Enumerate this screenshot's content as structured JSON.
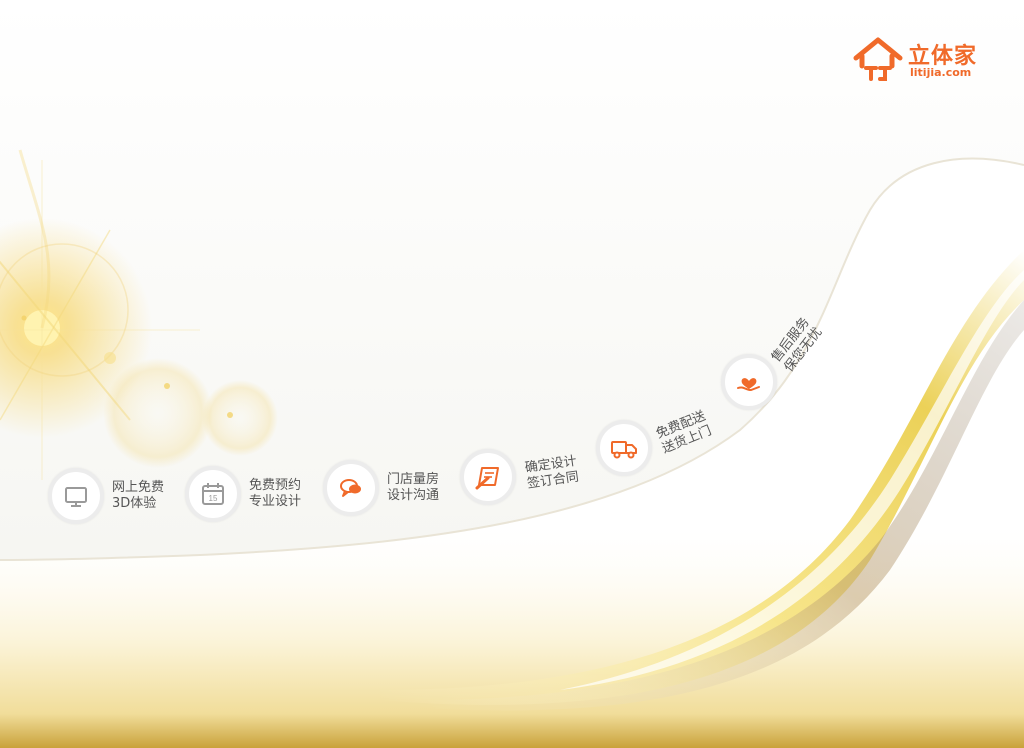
{
  "brand": {
    "name": "立体家",
    "domain": "litijia.com",
    "color": "#f06a2a"
  },
  "colors": {
    "accent": "#f06a2a",
    "gold": "#f2d36b",
    "ring": "#ececec",
    "text": "#555555"
  },
  "steps": [
    {
      "icon": "monitor-icon",
      "line1": "网上免费",
      "line2": "3D体验",
      "icon_color": "#9a9a9a"
    },
    {
      "icon": "calendar-icon",
      "line1": "免费预约",
      "line2": "专业设计",
      "icon_color": "#9a9a9a",
      "calendar_day": "15"
    },
    {
      "icon": "chat-bubbles-icon",
      "line1": "门店量房",
      "line2": "设计沟通",
      "icon_color": "#f06a2a"
    },
    {
      "icon": "contract-pen-icon",
      "line1": "确定设计",
      "line2": "签订合同",
      "icon_color": "#f06a2a"
    },
    {
      "icon": "delivery-truck-icon",
      "line1": "免费配送",
      "line2": "送货上门",
      "icon_color": "#f06a2a"
    },
    {
      "icon": "heart-hand-icon",
      "line1": "售后服务",
      "line2": "保您无忧",
      "icon_color": "#f06a2a"
    }
  ]
}
